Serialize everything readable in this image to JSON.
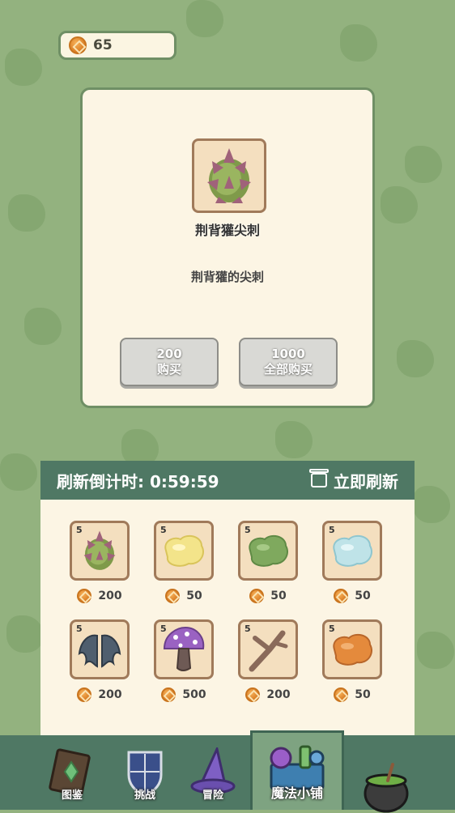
{
  "header": {
    "coins": "65"
  },
  "detail": {
    "item_name": "荆背獾尖刺",
    "description": "荆背獾的尖刺",
    "buy_one": {
      "price": "200",
      "label": "购买"
    },
    "buy_all": {
      "price": "1000",
      "label": "全部购买"
    }
  },
  "shop": {
    "countdown_label": "刷新倒计时:",
    "countdown_time": "0:59:59",
    "refresh_label": "立即刷新",
    "items": [
      {
        "qty": "5",
        "price": "200",
        "icon": "spike-icon"
      },
      {
        "qty": "5",
        "price": "50",
        "icon": "yellow-slime-icon"
      },
      {
        "qty": "5",
        "price": "50",
        "icon": "green-slime-icon"
      },
      {
        "qty": "5",
        "price": "50",
        "icon": "blue-slime-icon"
      },
      {
        "qty": "5",
        "price": "200",
        "icon": "bat-wings-icon"
      },
      {
        "qty": "5",
        "price": "500",
        "icon": "purple-mushroom-icon"
      },
      {
        "qty": "5",
        "price": "200",
        "icon": "branch-icon"
      },
      {
        "qty": "5",
        "price": "50",
        "icon": "orange-slime-icon"
      }
    ]
  },
  "nav": {
    "tabs": [
      {
        "label": "图鉴",
        "icon": "book-icon"
      },
      {
        "label": "挑战",
        "icon": "shield-icon"
      },
      {
        "label": "冒险",
        "icon": "witch-hat-icon"
      },
      {
        "label": "魔法小铺",
        "icon": "potion-shop-icon",
        "active": true
      },
      {
        "label": "",
        "icon": "cauldron-icon"
      }
    ]
  },
  "colors": {
    "background": "#93b27f",
    "panel": "#fcf5e4",
    "header": "#4f7864",
    "coin": "#d87b22"
  }
}
